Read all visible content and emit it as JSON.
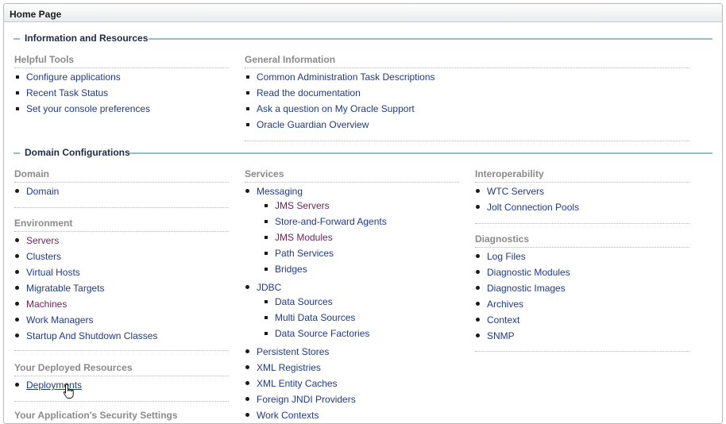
{
  "panel_title": "Home Page",
  "info_section": {
    "title": "Information and Resources",
    "helpful_tools": {
      "title": "Helpful Tools",
      "items": [
        "Configure applications",
        "Recent Task Status",
        "Set your console preferences"
      ]
    },
    "general_information": {
      "title": "General Information",
      "items": [
        "Common Administration Task Descriptions",
        "Read the documentation",
        "Ask a question on My Oracle Support",
        "Oracle Guardian Overview"
      ]
    }
  },
  "domain_section": {
    "title": "Domain Configurations",
    "domain": {
      "title": "Domain",
      "items": [
        "Domain"
      ]
    },
    "environment": {
      "title": "Environment",
      "items": [
        "Servers",
        "Clusters",
        "Virtual Hosts",
        "Migratable Targets",
        "Machines",
        "Work Managers",
        "Startup And Shutdown Classes"
      ]
    },
    "deployed_resources": {
      "title": "Your Deployed Resources",
      "items": [
        "Deployments"
      ]
    },
    "app_config_partial": "Your Application's Security Settings",
    "services": {
      "title": "Services",
      "messaging": {
        "label": "Messaging",
        "children": [
          "JMS Servers",
          "Store-and-Forward Agents",
          "JMS Modules",
          "Path Services",
          "Bridges"
        ]
      },
      "jdbc": {
        "label": "JDBC",
        "children": [
          "Data Sources",
          "Multi Data Sources",
          "Data Source Factories"
        ]
      },
      "others": [
        "Persistent Stores",
        "XML Registries",
        "XML Entity Caches",
        "Foreign JNDI Providers",
        "Work Contexts"
      ]
    },
    "interoperability": {
      "title": "Interoperability",
      "items": [
        "WTC Servers",
        "Jolt Connection Pools"
      ]
    },
    "diagnostics": {
      "title": "Diagnostics",
      "items": [
        "Log Files",
        "Diagnostic Modules",
        "Diagnostic Images",
        "Archives",
        "Context",
        "SNMP"
      ]
    }
  },
  "colors": {
    "accent_line": "#8fc1c1",
    "link": "#1f3a8a",
    "visited_link": "#6b1f5b",
    "heading_gray": "#8a8a8a"
  }
}
